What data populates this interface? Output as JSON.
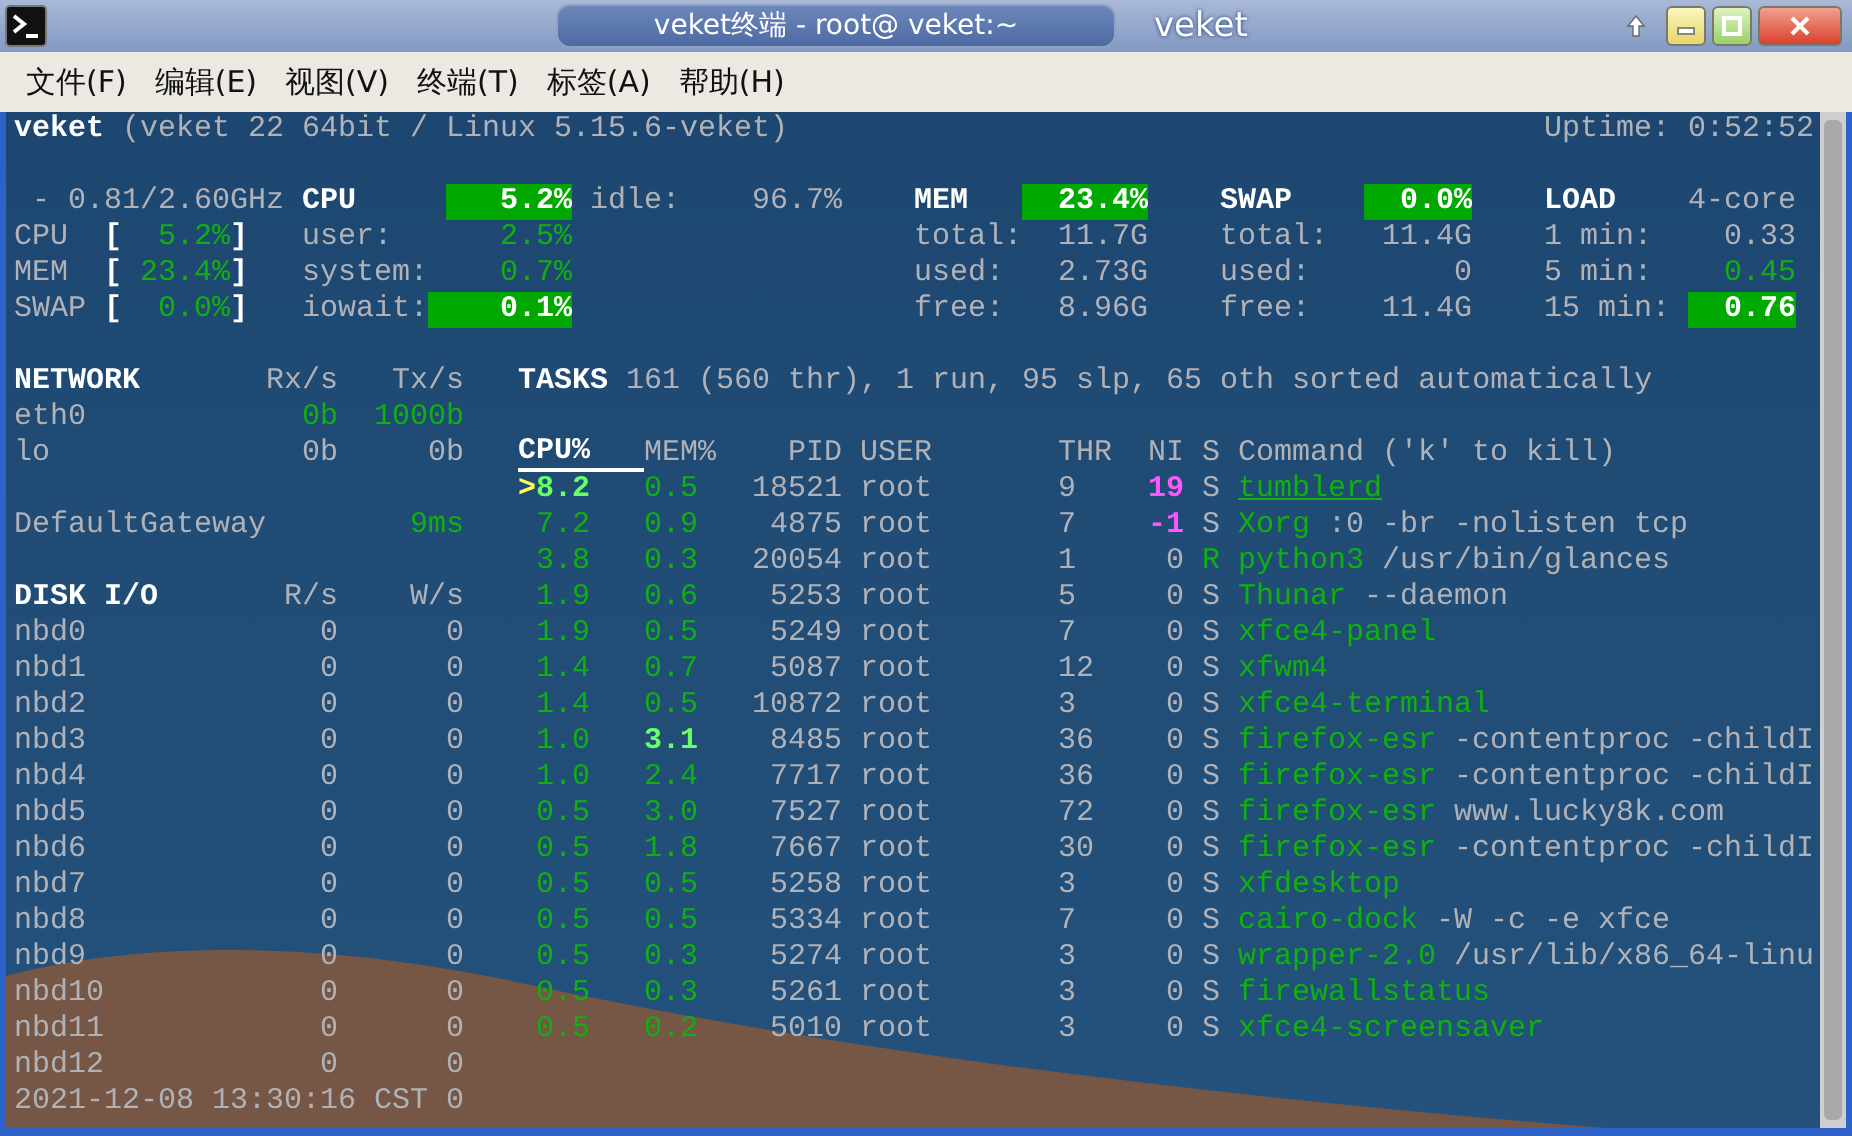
{
  "window": {
    "title": "veket终端 - root@ veket:~",
    "label": "veket"
  },
  "menu": [
    "文件(F)",
    "编辑(E)",
    "视图(V)",
    "终端(T)",
    "标签(A)",
    "帮助(H)"
  ],
  "header": {
    "host": "veket",
    "system": "(veket 22 64bit / Linux 5.15.6-veket)",
    "uptime": "Uptime: 0:52:52"
  },
  "quicklook": {
    "cpu_freq": "- 0.81/2.60GHz",
    "rows": [
      {
        "label": "CPU",
        "open": "[",
        "value": "5.2%",
        "close": "]",
        "kind": "ok"
      },
      {
        "label": "MEM",
        "open": "[",
        "value": "23.4%",
        "close": "]",
        "kind": "ok"
      },
      {
        "label": "SWAP",
        "open": "[",
        "value": "0.0%",
        "close": "]",
        "kind": "ok"
      }
    ]
  },
  "cpu": {
    "title": "CPU",
    "total": {
      "text": "5.2%",
      "kind": "bar"
    },
    "rows": [
      {
        "label": "idle:",
        "value": "96.7%",
        "kind": "default"
      },
      {
        "label": "user:",
        "value": "2.5%",
        "kind": "ok"
      },
      {
        "label": "system:",
        "value": "0.7%",
        "kind": "ok"
      },
      {
        "label": "iowait:",
        "value": "0.1%",
        "kind": "bar"
      }
    ]
  },
  "mem": {
    "title": "MEM",
    "total": {
      "text": "23.4%",
      "kind": "bar"
    },
    "rows": [
      {
        "label": "total:",
        "value": "11.7G",
        "kind": "default"
      },
      {
        "label": "used:",
        "value": "2.73G",
        "kind": "default"
      },
      {
        "label": "free:",
        "value": "8.96G",
        "kind": "default"
      }
    ]
  },
  "swap": {
    "title": "SWAP",
    "total": {
      "text": "0.0%",
      "kind": "bar"
    },
    "rows": [
      {
        "label": "total:",
        "value": "11.4G",
        "kind": "default"
      },
      {
        "label": "used:",
        "value": "0",
        "kind": "default"
      },
      {
        "label": "free:",
        "value": "11.4G",
        "kind": "default"
      }
    ]
  },
  "load": {
    "title": "LOAD",
    "cores": "4-core",
    "rows": [
      {
        "label": "1 min:",
        "value": "0.33",
        "kind": "default"
      },
      {
        "label": "5 min:",
        "value": "0.45",
        "kind": "ok"
      },
      {
        "label": "15 min:",
        "value": "0.76",
        "kind": "bar"
      }
    ]
  },
  "network": {
    "title": "NETWORK",
    "columns": [
      "Rx/s",
      "Tx/s"
    ],
    "rows": [
      {
        "name": "eth0",
        "rx": {
          "text": "0b",
          "kind": "ok"
        },
        "tx": {
          "text": "1000b",
          "kind": "ok"
        }
      },
      {
        "name": "lo",
        "rx": {
          "text": "0b",
          "kind": "default"
        },
        "tx": {
          "text": "0b",
          "kind": "default"
        }
      }
    ],
    "gateway": {
      "name": "DefaultGateway",
      "value": "9ms",
      "kind": "ok"
    }
  },
  "tasks": {
    "title": "TASKS",
    "summary": "161 (560 thr), 1 run, 95 slp, 65 oth sorted automatically"
  },
  "processes": {
    "columns": [
      {
        "label": "CPU%",
        "sorted": true
      },
      {
        "label": "MEM%",
        "sorted": false
      },
      {
        "label": "PID",
        "sorted": false
      },
      {
        "label": "USER",
        "sorted": false
      },
      {
        "label": "THR",
        "sorted": false
      },
      {
        "label": "NI",
        "sorted": false
      },
      {
        "label": "S",
        "sorted": false
      },
      {
        "label": "Command ('k' to kill)",
        "sorted": false
      }
    ],
    "rows": [
      {
        "marker": ">",
        "cpu": {
          "text": "8.2",
          "kind": "bright"
        },
        "mem": {
          "text": "0.5",
          "kind": "ok"
        },
        "pid": "18521",
        "user": "root",
        "thr": "9",
        "ni": {
          "text": "19",
          "kind": "nice"
        },
        "s": {
          "text": "S",
          "kind": "default"
        },
        "name": "tumblerd",
        "selected": true
      },
      {
        "cpu": {
          "text": "7.2",
          "kind": "ok"
        },
        "mem": {
          "text": "0.9",
          "kind": "ok"
        },
        "pid": "4875",
        "user": "root",
        "thr": "7",
        "ni": {
          "text": "-1",
          "kind": "nice"
        },
        "s": {
          "text": "S",
          "kind": "default"
        },
        "name": "Xorg",
        "args": ":0 -br -nolisten tcp",
        "selected": false
      },
      {
        "cpu": {
          "text": "3.8",
          "kind": "ok"
        },
        "mem": {
          "text": "0.3",
          "kind": "ok"
        },
        "pid": "20054",
        "user": "root",
        "thr": "1",
        "ni": {
          "text": "0",
          "kind": "default"
        },
        "s": {
          "text": "R",
          "kind": "ok"
        },
        "name": "python3",
        "args": "/usr/bin/glances",
        "selected": false
      },
      {
        "cpu": {
          "text": "1.9",
          "kind": "ok"
        },
        "mem": {
          "text": "0.6",
          "kind": "ok"
        },
        "pid": "5253",
        "user": "root",
        "thr": "5",
        "ni": {
          "text": "0",
          "kind": "default"
        },
        "s": {
          "text": "S",
          "kind": "default"
        },
        "name": "Thunar",
        "args": "--daemon",
        "selected": false
      },
      {
        "cpu": {
          "text": "1.9",
          "kind": "ok"
        },
        "mem": {
          "text": "0.5",
          "kind": "ok"
        },
        "pid": "5249",
        "user": "root",
        "thr": "7",
        "ni": {
          "text": "0",
          "kind": "default"
        },
        "s": {
          "text": "S",
          "kind": "default"
        },
        "name": "xfce4-panel",
        "selected": false
      },
      {
        "cpu": {
          "text": "1.4",
          "kind": "ok"
        },
        "mem": {
          "text": "0.7",
          "kind": "ok"
        },
        "pid": "5087",
        "user": "root",
        "thr": "12",
        "ni": {
          "text": "0",
          "kind": "default"
        },
        "s": {
          "text": "S",
          "kind": "default"
        },
        "name": "xfwm4",
        "selected": false
      },
      {
        "cpu": {
          "text": "1.4",
          "kind": "ok"
        },
        "mem": {
          "text": "0.5",
          "kind": "ok"
        },
        "pid": "10872",
        "user": "root",
        "thr": "3",
        "ni": {
          "text": "0",
          "kind": "default"
        },
        "s": {
          "text": "S",
          "kind": "default"
        },
        "name": "xfce4-terminal",
        "selected": false
      },
      {
        "cpu": {
          "text": "1.0",
          "kind": "ok"
        },
        "mem": {
          "text": "3.1",
          "kind": "bright"
        },
        "pid": "8485",
        "user": "root",
        "thr": "36",
        "ni": {
          "text": "0",
          "kind": "default"
        },
        "s": {
          "text": "S",
          "kind": "default"
        },
        "name": "firefox-esr",
        "args": "-contentproc -childI",
        "selected": false
      },
      {
        "cpu": {
          "text": "1.0",
          "kind": "ok"
        },
        "mem": {
          "text": "2.4",
          "kind": "ok"
        },
        "pid": "7717",
        "user": "root",
        "thr": "36",
        "ni": {
          "text": "0",
          "kind": "default"
        },
        "s": {
          "text": "S",
          "kind": "default"
        },
        "name": "firefox-esr",
        "args": "-contentproc -childI",
        "selected": false
      },
      {
        "cpu": {
          "text": "0.5",
          "kind": "ok"
        },
        "mem": {
          "text": "3.0",
          "kind": "ok"
        },
        "pid": "7527",
        "user": "root",
        "thr": "72",
        "ni": {
          "text": "0",
          "kind": "default"
        },
        "s": {
          "text": "S",
          "kind": "default"
        },
        "name": "firefox-esr",
        "args": "www.lucky8k.com",
        "selected": false
      },
      {
        "cpu": {
          "text": "0.5",
          "kind": "ok"
        },
        "mem": {
          "text": "1.8",
          "kind": "ok"
        },
        "pid": "7667",
        "user": "root",
        "thr": "30",
        "ni": {
          "text": "0",
          "kind": "default"
        },
        "s": {
          "text": "S",
          "kind": "default"
        },
        "name": "firefox-esr",
        "args": "-contentproc -childI",
        "selected": false
      },
      {
        "cpu": {
          "text": "0.5",
          "kind": "ok"
        },
        "mem": {
          "text": "0.5",
          "kind": "ok"
        },
        "pid": "5258",
        "user": "root",
        "thr": "3",
        "ni": {
          "text": "0",
          "kind": "default"
        },
        "s": {
          "text": "S",
          "kind": "default"
        },
        "name": "xfdesktop",
        "selected": false
      },
      {
        "cpu": {
          "text": "0.5",
          "kind": "ok"
        },
        "mem": {
          "text": "0.5",
          "kind": "ok"
        },
        "pid": "5334",
        "user": "root",
        "thr": "7",
        "ni": {
          "text": "0",
          "kind": "default"
        },
        "s": {
          "text": "S",
          "kind": "default"
        },
        "name": "cairo-dock",
        "args": "-W -c -e xfce",
        "selected": false
      },
      {
        "cpu": {
          "text": "0.5",
          "kind": "ok"
        },
        "mem": {
          "text": "0.3",
          "kind": "ok"
        },
        "pid": "5274",
        "user": "root",
        "thr": "3",
        "ni": {
          "text": "0",
          "kind": "default"
        },
        "s": {
          "text": "S",
          "kind": "default"
        },
        "name": "wrapper-2.0",
        "args": "/usr/lib/x86_64-linu",
        "selected": false
      },
      {
        "cpu": {
          "text": "0.5",
          "kind": "ok"
        },
        "mem": {
          "text": "0.3",
          "kind": "ok"
        },
        "pid": "5261",
        "user": "root",
        "thr": "3",
        "ni": {
          "text": "0",
          "kind": "default"
        },
        "s": {
          "text": "S",
          "kind": "default"
        },
        "name": "firewallstatus",
        "selected": false
      },
      {
        "cpu": {
          "text": "0.5",
          "kind": "ok"
        },
        "mem": {
          "text": "0.2",
          "kind": "ok"
        },
        "pid": "5010",
        "user": "root",
        "thr": "3",
        "ni": {
          "text": "0",
          "kind": "default"
        },
        "s": {
          "text": "S",
          "kind": "default"
        },
        "name": "xfce4-screensaver",
        "selected": false
      }
    ]
  },
  "disk": {
    "title": "DISK I/O",
    "columns": [
      "R/s",
      "W/s"
    ],
    "rows": [
      {
        "name": "nbd0",
        "read": "0",
        "write": "0"
      },
      {
        "name": "nbd1",
        "read": "0",
        "write": "0"
      },
      {
        "name": "nbd2",
        "read": "0",
        "write": "0"
      },
      {
        "name": "nbd3",
        "read": "0",
        "write": "0"
      },
      {
        "name": "nbd4",
        "read": "0",
        "write": "0"
      },
      {
        "name": "nbd5",
        "read": "0",
        "write": "0"
      },
      {
        "name": "nbd6",
        "read": "0",
        "write": "0"
      },
      {
        "name": "nbd7",
        "read": "0",
        "write": "0"
      },
      {
        "name": "nbd8",
        "read": "0",
        "write": "0"
      },
      {
        "name": "nbd9",
        "read": "0",
        "write": "0"
      },
      {
        "name": "nbd10",
        "read": "0",
        "write": "0"
      },
      {
        "name": "nbd11",
        "read": "0",
        "write": "0"
      },
      {
        "name": "nbd12",
        "read": "0",
        "write": "0"
      }
    ]
  },
  "footer": {
    "timestamp": "2021-12-08 13:30:16 CST",
    "column_2": "0"
  }
}
